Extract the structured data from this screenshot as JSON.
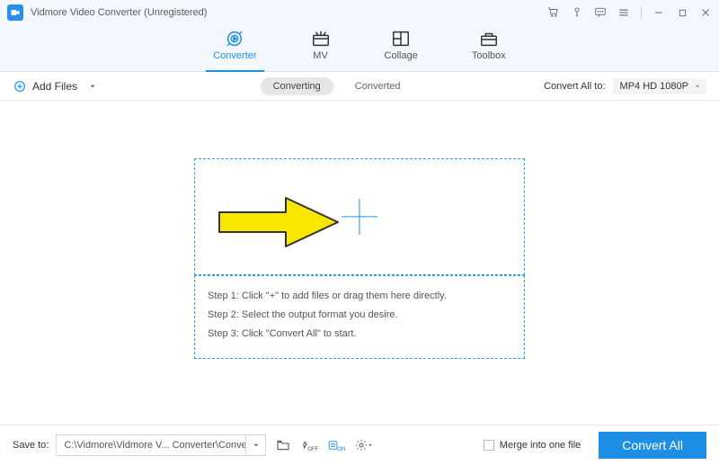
{
  "titlebar": {
    "app_title": "Vidmore Video Converter (Unregistered)"
  },
  "tabs": {
    "converter": "Converter",
    "mv": "MV",
    "collage": "Collage",
    "toolbox": "Toolbox"
  },
  "actionbar": {
    "add_files": "Add Files",
    "mode_converting": "Converting",
    "mode_converted": "Converted",
    "convert_all_to": "Convert All to:",
    "format_selected": "MP4 HD 1080P"
  },
  "steps": {
    "s1": "Step 1: Click \"+\" to add files or drag them here directly.",
    "s2": "Step 2: Select the output format you desire.",
    "s3": "Step 3: Click \"Convert All\" to start."
  },
  "bottombar": {
    "save_to": "Save to:",
    "path": "C:\\Vidmore\\Vidmore V... Converter\\Converted",
    "hw_off_sub": "OFF",
    "hw_on_sub": "ON",
    "merge_label": "Merge into one file",
    "convert_all_btn": "Convert All"
  }
}
